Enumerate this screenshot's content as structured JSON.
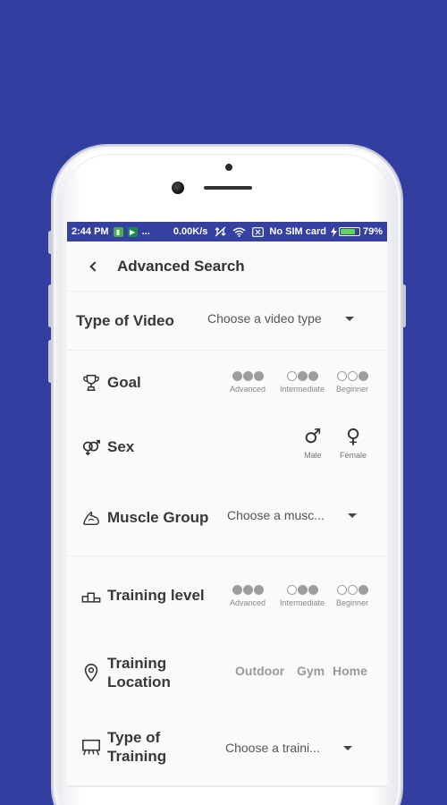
{
  "status_bar": {
    "time": "2:44 PM",
    "ellipsis": "...",
    "speed": "0.00K/s",
    "sim": "No SIM card",
    "battery": "79%",
    "battery_level": 0.79,
    "color": "#3441a0"
  },
  "header": {
    "title": "Advanced Search",
    "back_icon": "chevron-left-icon"
  },
  "type_of_video": {
    "label": "Type of Video",
    "placeholder": "Choose a video type"
  },
  "goal": {
    "label": "Goal",
    "icon": "trophy-icon",
    "options": [
      {
        "label": "Advanced",
        "filled": 3
      },
      {
        "label": "Intermediate",
        "filled": 2
      },
      {
        "label": "Beginner",
        "filled": 1
      }
    ]
  },
  "sex": {
    "label": "Sex",
    "icon": "gender-icon",
    "options": [
      {
        "label": "Male",
        "symbol": "♂"
      },
      {
        "label": "Female",
        "symbol": "♀"
      }
    ]
  },
  "muscle_group": {
    "label": "Muscle Group",
    "icon": "muscle-icon",
    "placeholder": "Choose a musc..."
  },
  "training_level": {
    "label": "Training level",
    "icon": "podium-icon",
    "options": [
      {
        "label": "Advanced",
        "filled": 3
      },
      {
        "label": "Intermediate",
        "filled": 2
      },
      {
        "label": "Beginner",
        "filled": 1
      }
    ]
  },
  "training_location": {
    "label_line1": "Training",
    "label_line2": "Location",
    "icon": "location-pin-icon",
    "options": [
      "Outdoor",
      "Gym",
      "Home"
    ]
  },
  "type_of_training": {
    "label_line1": "Type of",
    "label_line2": "Training",
    "icon": "easel-icon",
    "placeholder": "Choose a traini..."
  },
  "colors": {
    "background": "#323fa0",
    "dot": "#9e9e9e"
  }
}
